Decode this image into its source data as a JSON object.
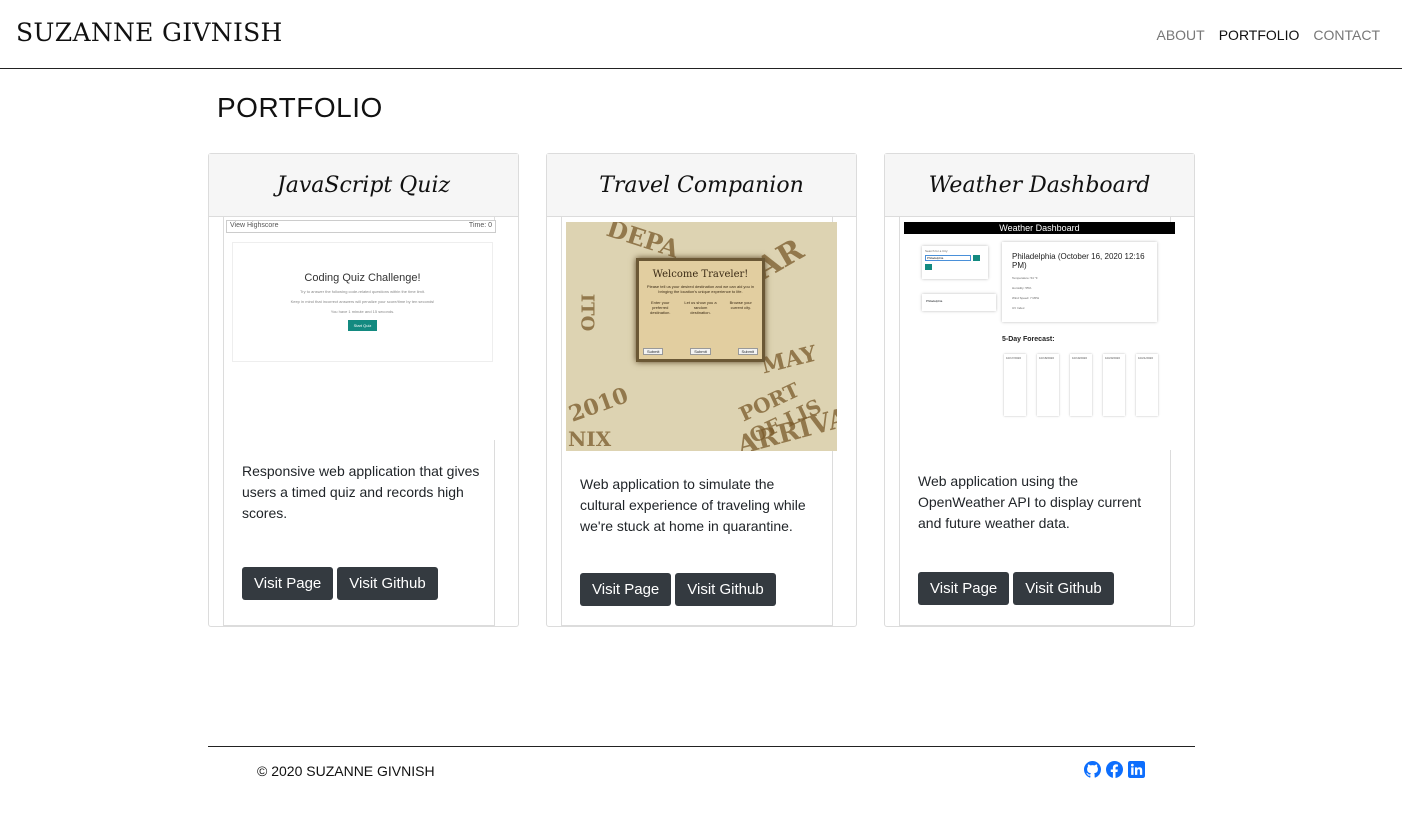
{
  "brand": "SUZANNE GIVNISH",
  "nav": [
    "ABOUT",
    "PORTFOLIO",
    "CONTACT"
  ],
  "page_title": "PORTFOLIO",
  "projects": [
    {
      "title": "JavaScript Quiz",
      "description": "Responsive web application that gives users a timed quiz and records high scores.",
      "visit_page": "Visit Page",
      "visit_github": "Visit Github",
      "screenshot": {
        "view_highscore": "View Highscore",
        "time": "Time: 0",
        "heading": "Coding Quiz Challenge!",
        "line1": "Try to answer the following code-related questions within the time limit.",
        "line2": "Keep in mind that incorrect answers will penalize your score/time by ten seconds!",
        "line3": "You have 1 minute and 15 seconds.",
        "start": "Start Quiz"
      }
    },
    {
      "title": "Travel Companion",
      "description": "Web application to simulate the cultural experience of traveling while we're stuck at home in quarantine.",
      "visit_page": "Visit Page",
      "visit_github": "Visit Github",
      "screenshot": {
        "heading": "Welcome Traveler!",
        "text": "Please tell us your desired destination and we can aid you in bringing the location's unique experience to life.",
        "col1": "Enter your preferred destination.",
        "col2": "Let us show you a random destination.",
        "col3": "Browse your current city.",
        "submit": "Submit"
      }
    },
    {
      "title": "Weather Dashboard",
      "description": "Web application using the OpenWeather API to display current and future weather data.",
      "visit_page": "Visit Page",
      "visit_github": "Visit Github",
      "screenshot": {
        "header": "Weather Dashboard",
        "search_label": "Search for a City:",
        "search_value": "Philadelphia",
        "history_item": "Philadelphia",
        "city": "Philadelphia (October 16, 2020 12:16 PM)",
        "temp": "Temperature: 54 °F",
        "humidity": "Humidity: 55%",
        "wind": "Wind Speed: 7 MPH",
        "uv": "UV Index:",
        "forecast_title": "5-Day Forecast:",
        "days": [
          "10/17/2020",
          "10/18/2020",
          "10/19/2020",
          "10/20/2020",
          "10/21/2020"
        ]
      }
    }
  ],
  "footer": {
    "copyright": "© 2020 SUZANNE GIVNISH",
    "icons": [
      "github-icon",
      "facebook-icon",
      "linkedin-icon"
    ]
  },
  "colors": {
    "button_bg": "#343a40",
    "social_blue": "#0d6efd"
  }
}
